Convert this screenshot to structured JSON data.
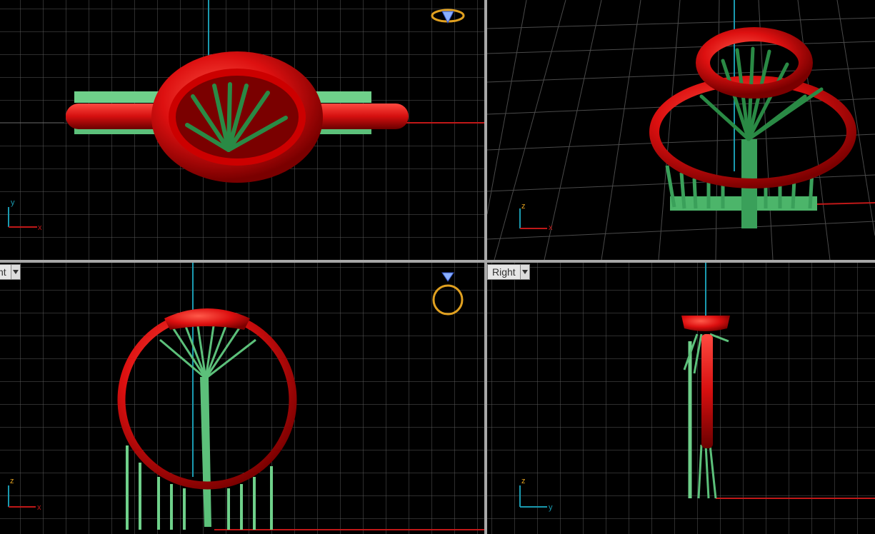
{
  "viewports": {
    "top": {
      "axis_v": "y",
      "axis_h": "x"
    },
    "perspective": {
      "axis_v": "z",
      "axis_h": "x"
    },
    "front": {
      "tab_label": "nt",
      "axis_v": "z",
      "axis_h": "x"
    },
    "right": {
      "tab_label": "Right",
      "axis_v": "z",
      "axis_h": "y"
    }
  },
  "icons": {
    "dropdown": "chevron-down-icon",
    "ring_top": "ring-top-view-icon",
    "ring_front": "ring-front-view-icon"
  },
  "colors": {
    "background": "#000000",
    "grid": "#5a5a5a",
    "grid_minor": "#2e2e2e",
    "ring": "#e01010",
    "supports": "#3f9e55",
    "axis_x": "#c01818",
    "axis_y": "#1a9ab0",
    "divider": "#a8a8a8",
    "gizmo_gold": "#e0a020"
  }
}
